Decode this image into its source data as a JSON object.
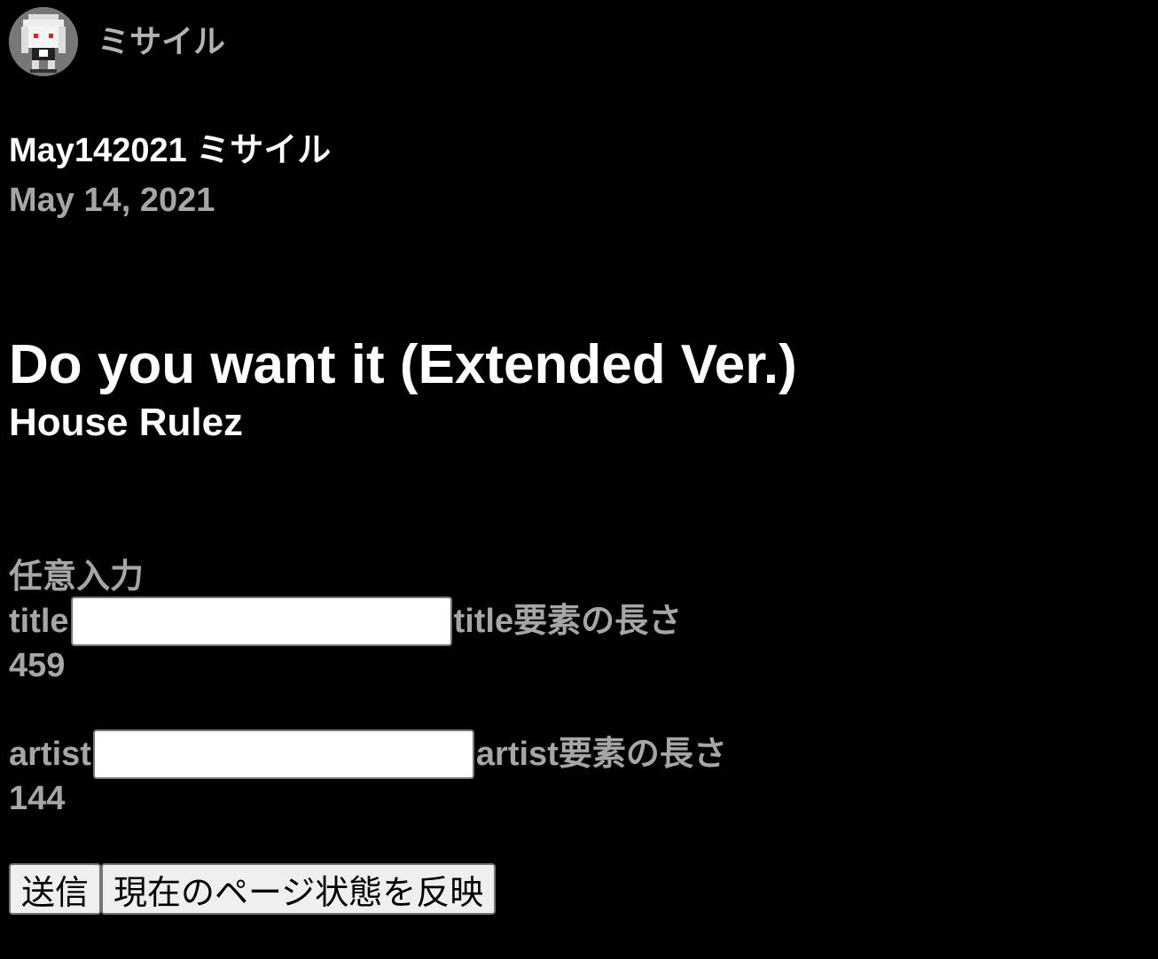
{
  "header": {
    "site_name": "ミサイル",
    "avatar_icon": "pixel-character-avatar"
  },
  "post": {
    "title": "May142021 ミサイル",
    "date": "May 14, 2021"
  },
  "song": {
    "title": "Do you want it (Extended Ver.)",
    "artist": "House Rulez"
  },
  "form": {
    "section_label": "任意入力",
    "title_label": "title",
    "title_value": "",
    "title_length_label": "title要素の長さ",
    "title_length_value": "459",
    "artist_label": "artist",
    "artist_value": "",
    "artist_length_label": "artist要素の長さ",
    "artist_length_value": "144"
  },
  "buttons": {
    "submit_label": "送信",
    "reflect_label": "現在のページ状態を反映"
  },
  "colors": {
    "background": "#000000",
    "heading": "#ffffff",
    "muted_text": "#a6a6a6"
  }
}
